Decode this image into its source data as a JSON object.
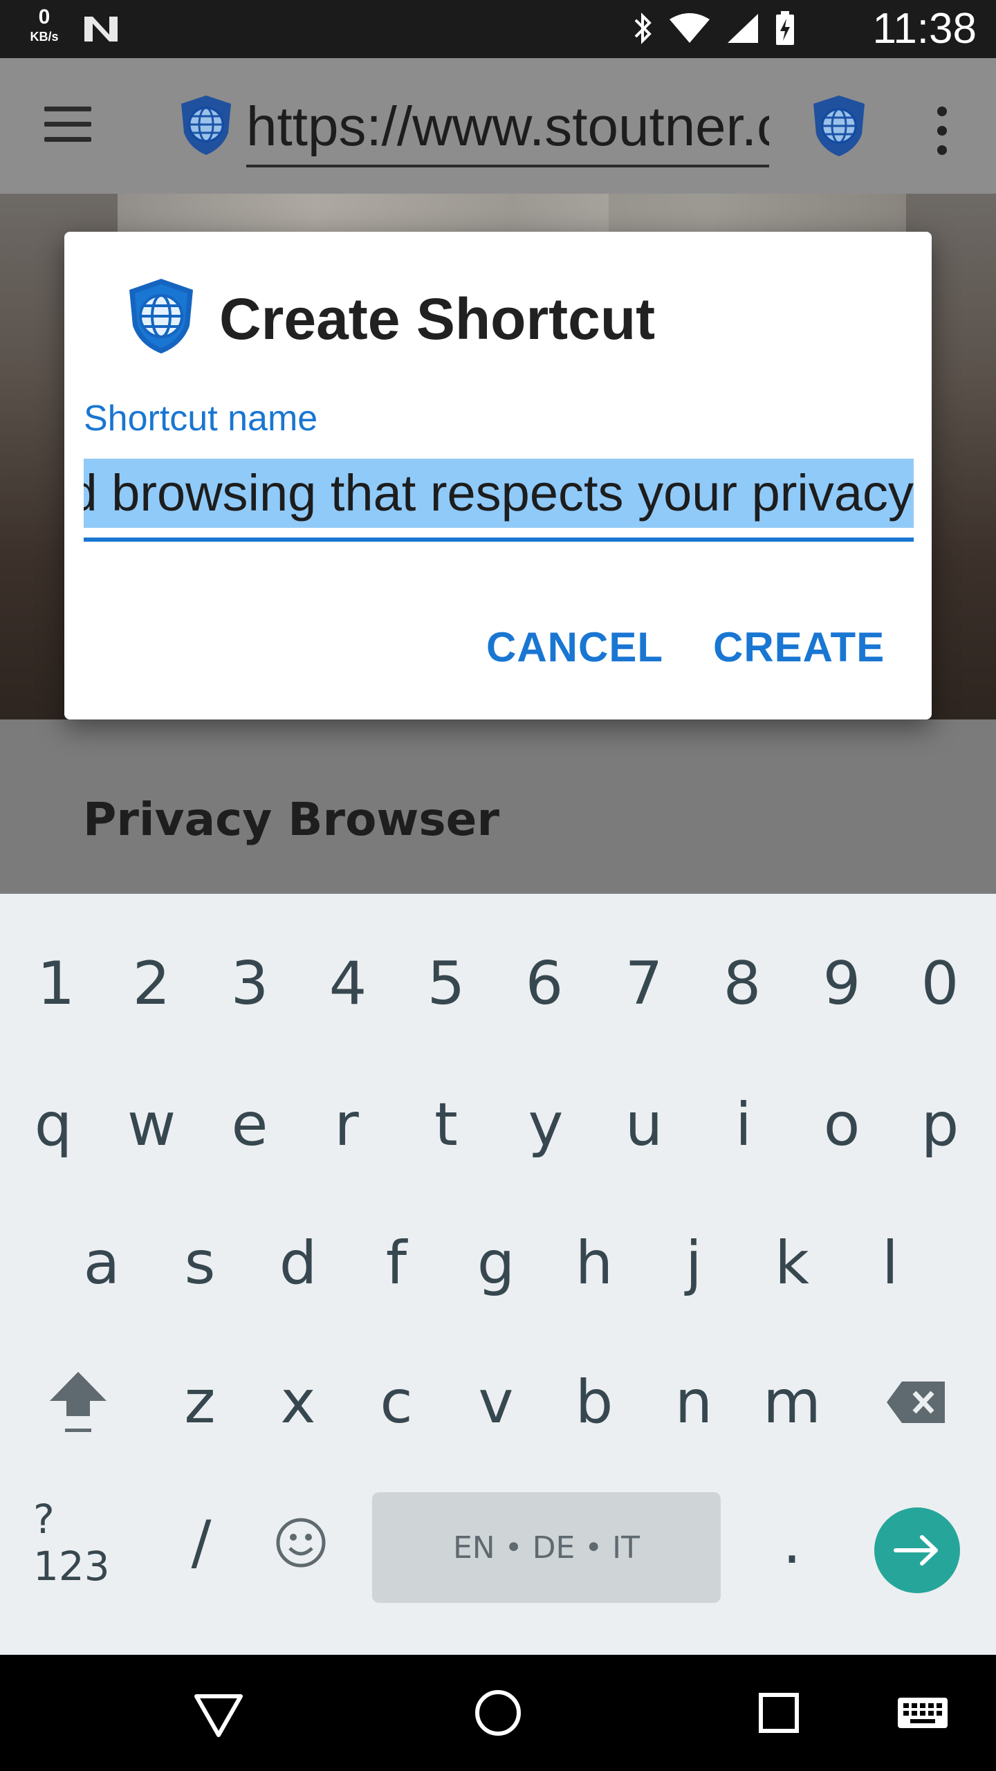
{
  "status_bar": {
    "net_speed": "0",
    "net_unit": "KB/s",
    "time": "11:38",
    "icons": [
      "notification-n-icon",
      "bluetooth-icon",
      "wifi-icon",
      "signal-icon",
      "battery-charging-icon"
    ]
  },
  "browser": {
    "url": "https://www.stoutner.com",
    "menu_icon": "hamburger-menu-icon",
    "overflow_icon": "overflow-menu-icon"
  },
  "page": {
    "heading": "Privacy Browser"
  },
  "dialog": {
    "title": "Create Shortcut",
    "field_label": "Shortcut name",
    "field_value": "Android browsing that respects your privacy",
    "cancel_label": "CANCEL",
    "create_label": "CREATE"
  },
  "keyboard": {
    "number_row": [
      "1",
      "2",
      "3",
      "4",
      "5",
      "6",
      "7",
      "8",
      "9",
      "0"
    ],
    "row1": [
      "q",
      "w",
      "e",
      "r",
      "t",
      "y",
      "u",
      "i",
      "o",
      "p"
    ],
    "row2": [
      "a",
      "s",
      "d",
      "f",
      "g",
      "h",
      "j",
      "k",
      "l"
    ],
    "row3": [
      "z",
      "x",
      "c",
      "v",
      "b",
      "n",
      "m"
    ],
    "symbols_key": "?123",
    "slash_key": "/",
    "period_key": ".",
    "space_label": "EN • DE • IT"
  },
  "colors": {
    "accent": "#1976d2",
    "selection": "#90caf9",
    "enter_key": "#26a69a",
    "keyboard_bg": "#eceff1",
    "key_text": "#37474f"
  }
}
